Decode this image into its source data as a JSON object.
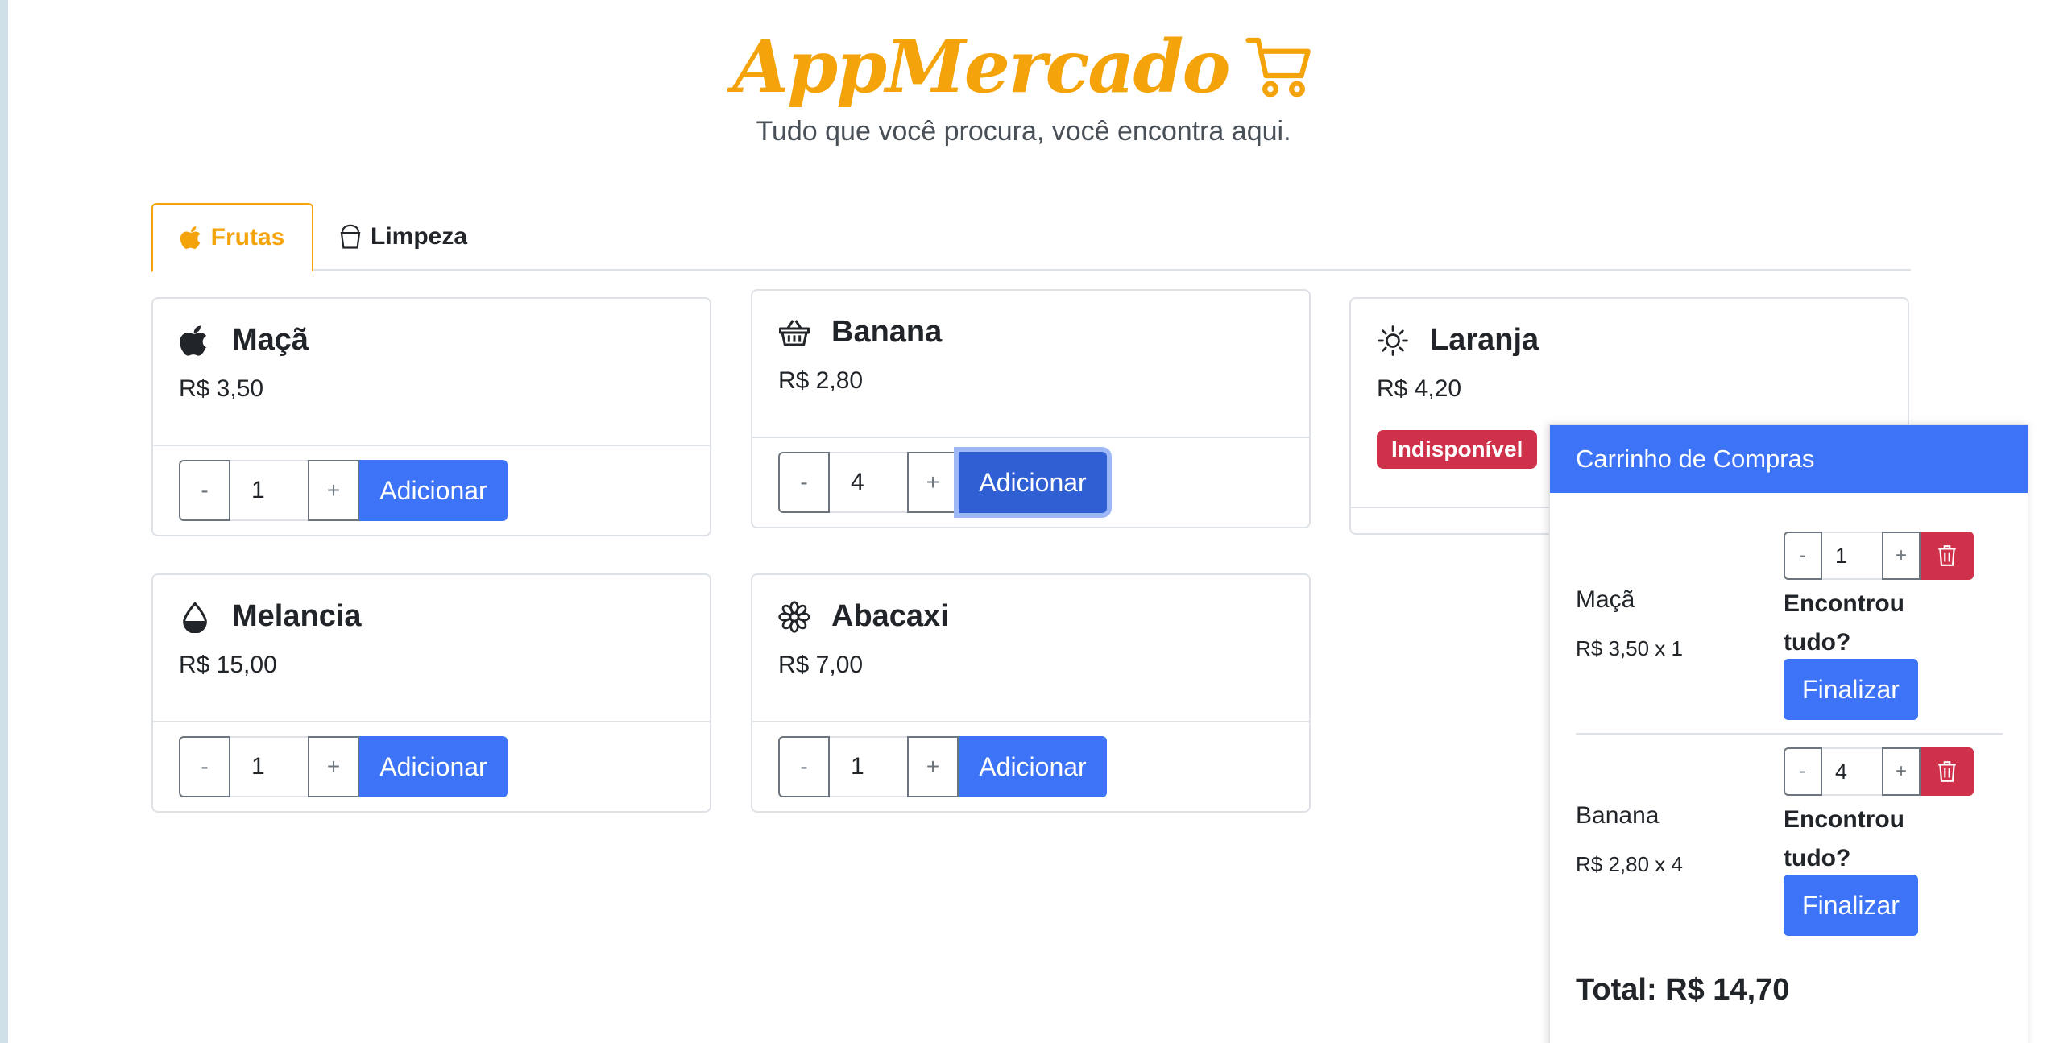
{
  "header": {
    "title": "AppMercado",
    "subtitle": "Tudo que você procura, você encontra aqui."
  },
  "tabs": [
    {
      "label": "Frutas",
      "icon": "apple-icon",
      "active": true
    },
    {
      "label": "Limpeza",
      "icon": "bucket-icon",
      "active": false
    }
  ],
  "products": [
    {
      "name": "Maçã",
      "price": "R$ 3,50",
      "qty": "1",
      "icon": "apple-icon",
      "available": true
    },
    {
      "name": "Banana",
      "price": "R$ 2,80",
      "qty": "4",
      "icon": "basket-icon",
      "available": true
    },
    {
      "name": "Laranja",
      "price": "R$ 4,20",
      "icon": "sun-icon",
      "available": false,
      "badge": "Indisponível"
    },
    {
      "name": "Melancia",
      "price": "R$ 15,00",
      "qty": "1",
      "icon": "droplet-half-icon",
      "available": true
    },
    {
      "name": "Abacaxi",
      "price": "R$ 7,00",
      "qty": "1",
      "icon": "flower-icon",
      "available": true
    }
  ],
  "buttons": {
    "minus": "-",
    "plus": "+",
    "add": "Adicionar",
    "finalize": "Finalizar"
  },
  "cart": {
    "title": "Carrinho de Compras",
    "items": [
      {
        "name": "Maçã",
        "line": "R$ 3,50 x 1",
        "qty": "1",
        "question": "Encontrou tudo?"
      },
      {
        "name": "Banana",
        "line": "R$ 2,80 x 4",
        "qty": "4",
        "question": "Encontrou tudo?"
      }
    ],
    "total": "Total: R$ 14,70"
  },
  "colors": {
    "brand": "#f5a30a",
    "primary": "#3d73f6",
    "danger": "#d0314a"
  }
}
